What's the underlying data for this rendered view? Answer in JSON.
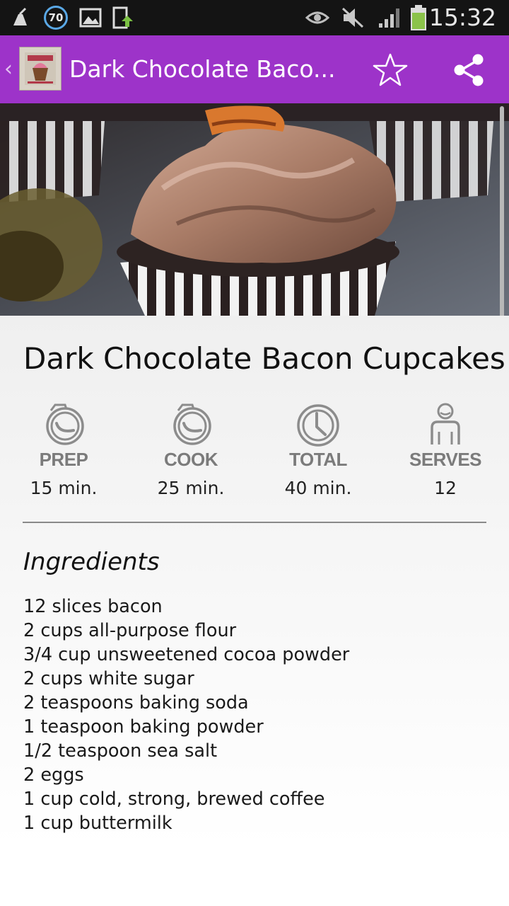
{
  "status_bar": {
    "time": "15:32",
    "notification_badge": "70",
    "icons": [
      "cleaner-icon",
      "speed-badge-icon",
      "image-icon",
      "download-icon",
      "eye-icon",
      "mute-icon",
      "signal-icon",
      "battery-icon"
    ]
  },
  "action_bar": {
    "title": "Dark Chocolate Baco...",
    "icons": [
      "back-chevron-icon",
      "app-icon",
      "star-icon",
      "share-icon"
    ],
    "background": "#9d33c9"
  },
  "recipe": {
    "title": "Dark Chocolate Bacon Cupcakes",
    "stats": [
      {
        "label": "PREP",
        "value": "15 min.",
        "icon": "stopwatch-icon"
      },
      {
        "label": "COOK",
        "value": "25 min.",
        "icon": "stopwatch-icon"
      },
      {
        "label": "TOTAL",
        "value": "40 min.",
        "icon": "clock-icon"
      },
      {
        "label": "SERVES",
        "value": "12",
        "icon": "person-icon"
      }
    ],
    "ingredients_title": "Ingredients",
    "ingredients": [
      "12 slices bacon",
      "2 cups all-purpose flour",
      "3/4 cup unsweetened cocoa powder",
      "2 cups white sugar",
      "2 teaspoons baking soda",
      "1 teaspoon baking powder",
      "1/2 teaspoon sea salt",
      "2 eggs",
      "1 cup cold, strong, brewed coffee",
      "1 cup buttermilk"
    ]
  },
  "colors": {
    "accent": "#9d33c9",
    "stat_label": "#7b7b7b",
    "icon_gray": "#8c8c8c"
  }
}
